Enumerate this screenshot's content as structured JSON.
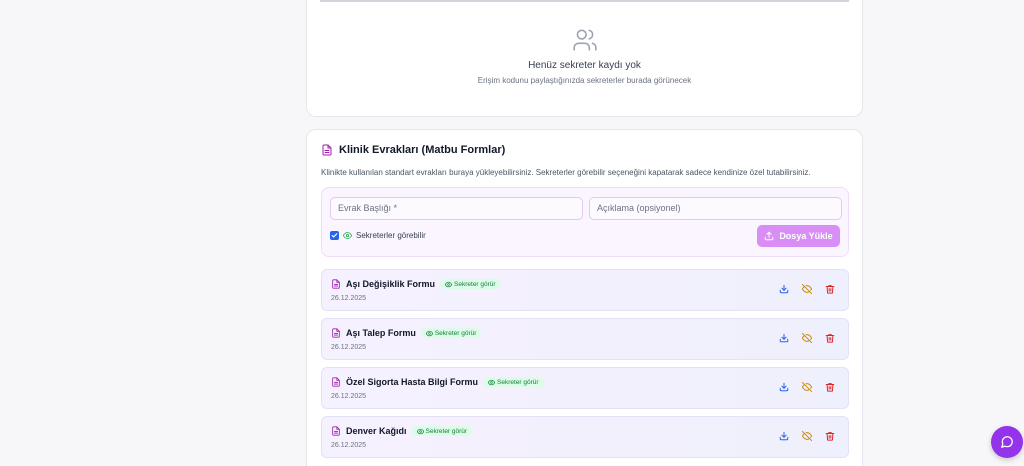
{
  "secretaries": {
    "empty_title": "Henüz sekreter kaydı yok",
    "empty_subtitle": "Erişim kodunu paylaştığınızda sekreterler burada görünecek"
  },
  "forms": {
    "title": "Klinik Evrakları (Matbu Formlar)",
    "description": "Klinikte kullanılan standart evrakları buraya yükleyebilirsiniz. Sekreterler görebilir seçeneğini kapatarak sadece kendinize özel tutabilirsiniz.",
    "title_placeholder": "Evrak Başlığı *",
    "desc_placeholder": "Açıklama (opsiyonel)",
    "visible_checkbox_label": "Sekreterler görebilir",
    "visible_checked": true,
    "upload_button": "Dosya Yükle",
    "items": [
      {
        "name": "Aşı Değişiklik Formu",
        "badge": "Sekreter görür",
        "date": "26.12.2025"
      },
      {
        "name": "Aşı Talep Formu",
        "badge": "Sekreter görür",
        "date": "26.12.2025"
      },
      {
        "name": "Özel Sigorta Hasta Bilgi Formu",
        "badge": "Sekreter görür",
        "date": "26.12.2025"
      },
      {
        "name": "Denver Kağıdı",
        "badge": "Sekreter görür",
        "date": "26.12.2025"
      }
    ]
  },
  "colors": {
    "accent": "#9333ea",
    "upload_button": "#d98ef5",
    "badge_bg": "#dcfce7",
    "badge_text": "#15803d",
    "download": "#2563eb",
    "hide": "#ca8a04",
    "delete": "#dc2626"
  },
  "icons": [
    "users-icon",
    "document-icon",
    "eye-icon",
    "upload-icon",
    "download-icon",
    "eye-off-icon",
    "trash-icon",
    "chat-icon"
  ]
}
